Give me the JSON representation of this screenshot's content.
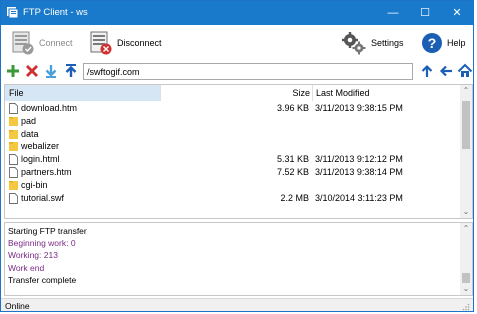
{
  "window": {
    "title": "FTP Client - ws",
    "minimize": "—",
    "maximize": "☐",
    "close": "✕"
  },
  "toolbar": {
    "connect_label": "Connect",
    "disconnect_label": "Disconnect",
    "settings_label": "Settings",
    "help_label": "Help"
  },
  "nav": {
    "path": "/swftogif.com"
  },
  "filelist": {
    "headers": {
      "file": "File",
      "size": "Size",
      "modified": "Last Modified"
    },
    "rows": [
      {
        "name": "download.htm",
        "type": "file",
        "size": "3.96 KB",
        "modified": "3/11/2013 9:38:15 PM"
      },
      {
        "name": "pad",
        "type": "folder",
        "size": "",
        "modified": ""
      },
      {
        "name": "data",
        "type": "folder",
        "size": "",
        "modified": ""
      },
      {
        "name": "webalizer",
        "type": "folder",
        "size": "",
        "modified": ""
      },
      {
        "name": "login.html",
        "type": "file",
        "size": "5.31 KB",
        "modified": "3/11/2013 9:12:12 PM"
      },
      {
        "name": "partners.htm",
        "type": "file",
        "size": "7.52 KB",
        "modified": "3/11/2013 9:38:14 PM"
      },
      {
        "name": "cgi-bin",
        "type": "folder",
        "size": "",
        "modified": ""
      },
      {
        "name": "tutorial.swf",
        "type": "file",
        "size": "2.2 MB",
        "modified": "3/10/2014 3:11:23 PM"
      }
    ]
  },
  "log": {
    "lines": [
      {
        "text": "Starting FTP transfer",
        "color": "#000000"
      },
      {
        "text": "Beginning work: 0",
        "color": "#7a2a86"
      },
      {
        "text": "Working: 213",
        "color": "#7a2a86"
      },
      {
        "text": "Work end",
        "color": "#7a2a86"
      },
      {
        "text": "Transfer complete",
        "color": "#000000"
      }
    ]
  },
  "status": {
    "text": "Online"
  },
  "colors": {
    "titlebar": "#1979ca",
    "accent_green": "#3a9a3a",
    "accent_red": "#d03030",
    "accent_blue": "#1a5fb4",
    "folder": "#f5c842",
    "log_purple": "#7a2a86"
  }
}
